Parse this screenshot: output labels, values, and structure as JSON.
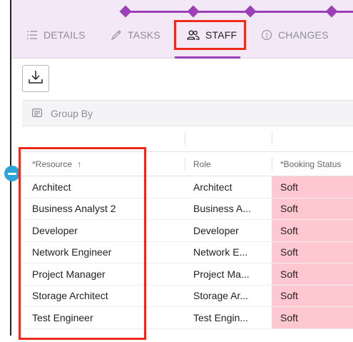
{
  "tabs": [
    {
      "label": "Details",
      "icon": "list-icon",
      "active": false
    },
    {
      "label": "Tasks",
      "icon": "pencil-icon",
      "active": false
    },
    {
      "label": "Staff",
      "icon": "people-icon",
      "active": true
    },
    {
      "label": "Changes",
      "icon": "changes-icon",
      "active": false
    }
  ],
  "toolbar": {
    "download_icon": "download-icon"
  },
  "group_by": {
    "label": "Group By",
    "icon": "group-by-icon"
  },
  "table": {
    "columns": [
      {
        "label": "*Resource",
        "sort": "ascending",
        "sort_icon": "arrow-up-icon"
      },
      {
        "label": "Role"
      },
      {
        "label": "*Booking Status"
      }
    ],
    "rows": [
      {
        "resource": "Architect",
        "role": "Architect",
        "status": "Soft"
      },
      {
        "resource": "Business Analyst 2",
        "role": "Business A...",
        "status": "Soft"
      },
      {
        "resource": "Developer",
        "role": "Developer",
        "status": "Soft"
      },
      {
        "resource": "Network Engineer",
        "role": "Network E...",
        "status": "Soft"
      },
      {
        "resource": "Project Manager",
        "role": "Project Ma...",
        "status": "Soft"
      },
      {
        "resource": "Storage Architect",
        "role": "Storage Ar...",
        "status": "Soft"
      },
      {
        "resource": "Test Engineer",
        "role": "Test Engin...",
        "status": "Soft"
      }
    ]
  },
  "colors": {
    "accent": "#9b40b8",
    "highlight": "#ee2a1c",
    "soft_status_bg": "#ffc7cf",
    "tab_bar_bg": "#f3e8f6",
    "handle": "#2da4d8"
  }
}
